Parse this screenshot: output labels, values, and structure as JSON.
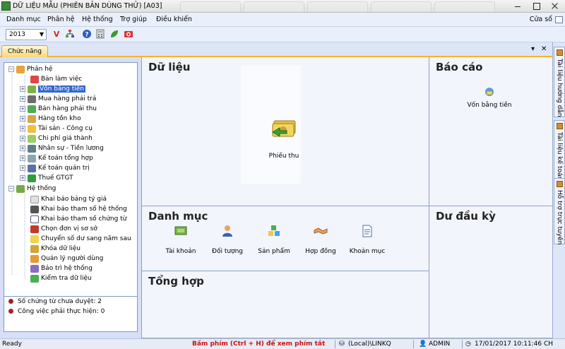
{
  "window": {
    "title": "DỮ LIỆU MẪU (PHIÊN BẢN DÙNG THỬ) [A03]"
  },
  "menubar": {
    "items": [
      "Danh mục",
      "Phân hệ",
      "Hệ thống",
      "Trợ giúp",
      "Điều khiển"
    ],
    "window_menu": "Cửa sổ"
  },
  "toolbar": {
    "year_value": "2013",
    "icons": [
      "filter-v-icon",
      "tree-structure-icon",
      "help-icon",
      "calculator-icon",
      "leaf-icon",
      "camera-icon"
    ]
  },
  "tabs": {
    "active": "Chức năng"
  },
  "tree": {
    "root1": "Phân hệ",
    "modules": [
      "Bàn làm việc",
      "Vốn bằng tiền",
      "Mua hàng phải trả",
      "Bán hàng phải thu",
      "Hàng tồn kho",
      "Tài sản - Công cụ",
      "Chi phí giá thành",
      "Nhân sự - Tiền lương",
      "Kế toán tổng hợp",
      "Kế toán quản trị",
      "Thuế GTGT"
    ],
    "selected_module": "Vốn bằng tiền",
    "root2": "Hệ thống",
    "system_items": [
      "Khai báo bảng tỷ giá",
      "Khai báo tham số hệ thống",
      "Khai báo tham số chứng từ",
      "Chọn đơn vị sơ sở",
      "Chuyển số dư sang năm sau",
      "Khóa dữ liệu",
      "Quản lý người dùng",
      "Bảo trì hệ thống",
      "Kiểm tra dữ liệu"
    ]
  },
  "tree_status": {
    "pending_docs": "Số chứng từ chưa duyệt: 2",
    "pending_tasks": "Công việc phải thực hiện: 0"
  },
  "sections": {
    "du_lieu": {
      "title": "Dữ liệu",
      "tiles": [
        {
          "label": "Phiếu thu",
          "icon": "cash-receipt-icon"
        }
      ]
    },
    "bao_cao": {
      "title": "Báo cáo",
      "tiles": [
        {
          "label": "Vốn bằng tiền",
          "icon": "report-cash-icon"
        }
      ]
    },
    "danh_muc": {
      "title": "Danh mục",
      "tiles": [
        {
          "label": "Tài khoản",
          "icon": "account-icon"
        },
        {
          "label": "Đối tượng",
          "icon": "person-icon"
        },
        {
          "label": "Sản phẩm",
          "icon": "product-icon"
        },
        {
          "label": "Hợp đồng",
          "icon": "handshake-icon"
        },
        {
          "label": "Khoản mục",
          "icon": "document-icon"
        }
      ]
    },
    "du_dau_ky": {
      "title": "Dư đầu kỳ"
    },
    "tong_hop": {
      "title": "Tổng hợp"
    }
  },
  "side_tabs": [
    "Tài liệu hướng dẫn",
    "Tài liệu kế toán",
    "Hỗ trợ trực tuyến"
  ],
  "statusbar": {
    "left": "Ready",
    "hint": "Bấm phím (Ctrl + H) để xem phím tắt",
    "server": "(Local)\\LINKQ",
    "user": "ADMIN",
    "datetime": "17/01/2017 10:11:46 CH"
  },
  "colors": {
    "hint_red": "#cc1111",
    "selection_blue": "#3366cc",
    "tab_accent": "#f5b52d"
  }
}
